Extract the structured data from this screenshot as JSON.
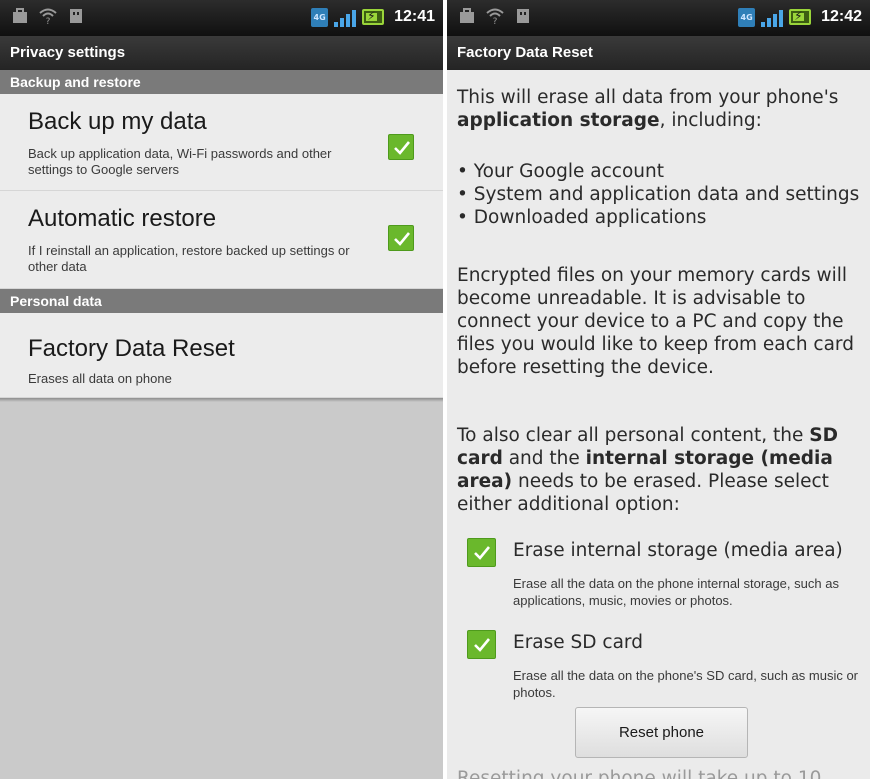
{
  "left_screen": {
    "status": {
      "time": "12:41",
      "network": "4G"
    },
    "title": "Privacy settings",
    "sections": [
      {
        "header": "Backup and restore"
      },
      {
        "header": "Personal data"
      }
    ],
    "items": [
      {
        "title": "Back up my data",
        "subtitle": "Back up application data, Wi-Fi passwords and other settings to Google servers",
        "checked": true
      },
      {
        "title": "Automatic restore",
        "subtitle": "If I reinstall an application, restore backed up settings or other data",
        "checked": true
      },
      {
        "title": "Factory Data Reset",
        "subtitle": "Erases all data on phone"
      }
    ]
  },
  "right_screen": {
    "status": {
      "time": "12:42",
      "network": "4G"
    },
    "title": "Factory Data Reset",
    "intro_prefix": "This will erase all data from your phone's ",
    "intro_bold": "application storage",
    "intro_suffix": ", including:",
    "bullets": [
      "• Your Google account",
      "• System and application data and settings",
      "• Downloaded applications"
    ],
    "encrypted_text": "Encrypted files on your memory cards will become unreadable. It is advisable to connect your device to a PC and copy the files you would like to keep from each card before resetting the device.",
    "clear_p1": "To also clear all personal content, the ",
    "clear_b1": "SD card",
    "clear_p2": " and the ",
    "clear_b2": "internal storage (media area)",
    "clear_p3": " needs to be erased. Please select either additional option:",
    "options": [
      {
        "title": "Erase internal storage (media area)",
        "subtitle": "Erase all the data on the phone internal storage, such as applications, music, movies or photos.",
        "checked": true
      },
      {
        "title": "Erase SD card",
        "subtitle": "Erase all the data on the phone's SD card, such as music or photos.",
        "checked": true
      }
    ],
    "reset_button": "Reset phone",
    "trailing_text": "Resetting your phone will take up to 10"
  },
  "colors": {
    "checkbox_green": "#6ab82c",
    "section_gray": "#7a7a7a",
    "titlebar_dark": "#2a2a2a"
  }
}
